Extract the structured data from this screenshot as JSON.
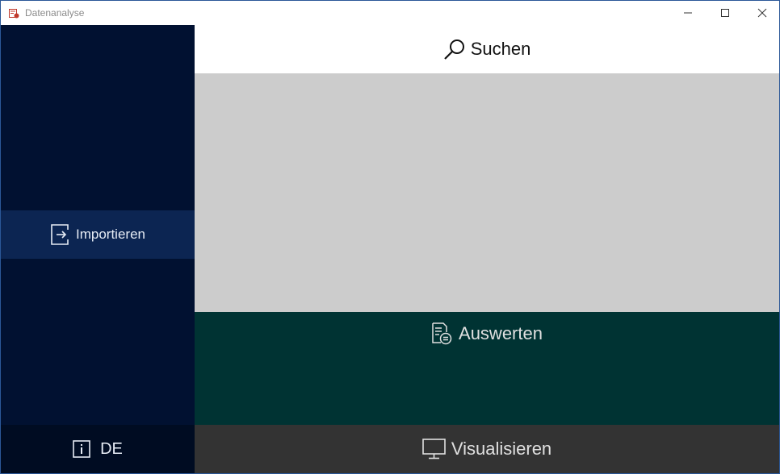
{
  "window": {
    "title": "Datenanalyse",
    "controls": {
      "minimize": "minimize-icon",
      "maximize": "maximize-icon",
      "close": "close-icon"
    }
  },
  "sidebar": {
    "import_label": "Importieren",
    "import_icon": "import-icon",
    "language_label": "DE",
    "info_icon": "info-icon"
  },
  "main": {
    "search_label": "Suchen",
    "search_icon": "search-icon",
    "evaluate_label": "Auswerten",
    "evaluate_icon": "evaluate-icon",
    "visualize_label": "Visualisieren",
    "visualize_icon": "monitor-icon"
  },
  "colors": {
    "sidebar": "#011131",
    "sidebar_selected": "#0c2552",
    "lang_bar": "#000c22",
    "content": "#cccccc",
    "evaluate": "#003333",
    "visualize": "#333333"
  }
}
